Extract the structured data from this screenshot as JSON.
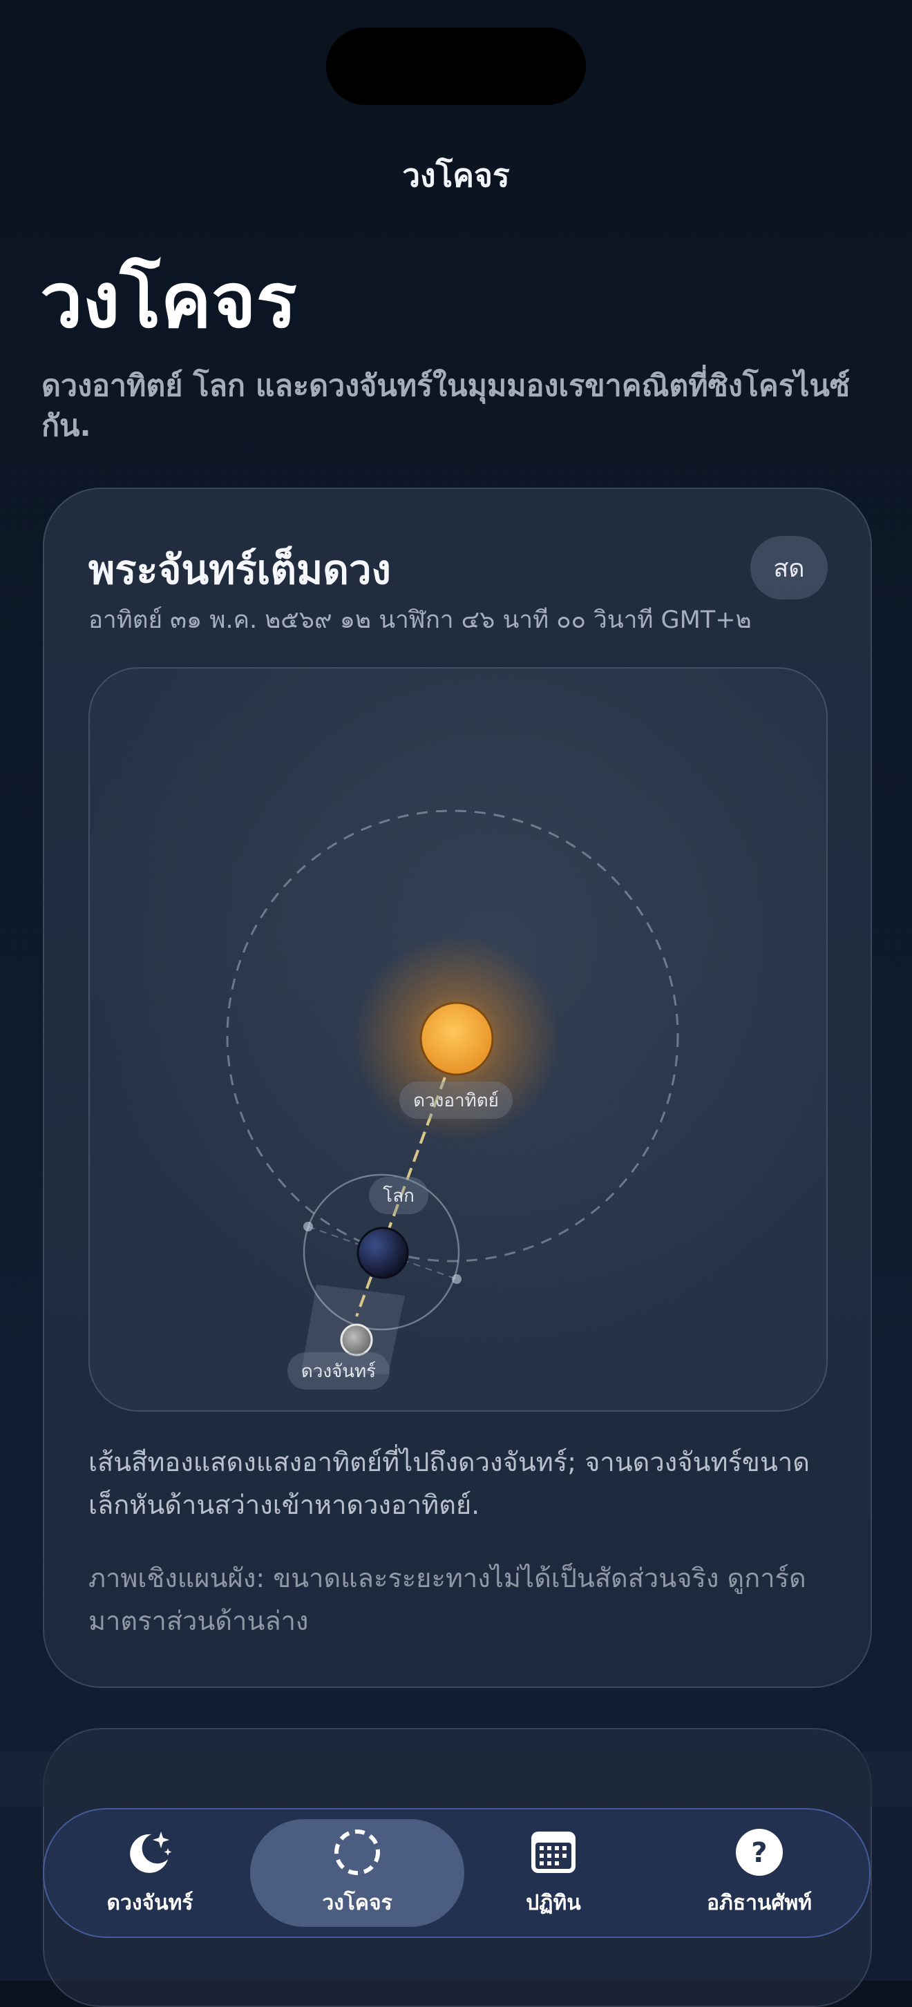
{
  "nav": {
    "title": "วงโคจร"
  },
  "header": {
    "title": "วงโคจร",
    "subtitle": "ดวงอาทิตย์ โลก และดวงจันทร์ในมุมมองเรขาคณิตที่ซิงโครไนซ์กัน."
  },
  "card": {
    "title": "พระจันทร์เต็มดวง",
    "badge": "สด",
    "date": "อาทิตย์ ๓๑ พ.ค. ๒๕๖๙ ๑๒ นาฬิกา ๔๖ นาที ๐๐ วินาที GMT+๒",
    "labels": {
      "sun": "ดวงอาทิตย์",
      "earth": "โลก",
      "moon": "ดวงจันทร์"
    },
    "note1": "เส้นสีทองแสดงแสงอาทิตย์ที่ไปถึงดวงจันทร์; จานดวงจันทร์ขนาดเล็กหันด้านสว่างเข้าหาดวงอาทิตย์.",
    "note2": "ภาพเชิงแผนผัง: ขนาดและระยะทางไม่ได้เป็นสัดส่วนจริง ดูการ์ดมาตราส่วนด้านล่าง"
  },
  "tabs": [
    {
      "label": "ดวงจันทร์",
      "icon": "moon-stars-icon",
      "active": false
    },
    {
      "label": "วงโคจร",
      "icon": "orbit-circle-icon",
      "active": true
    },
    {
      "label": "ปฏิทิน",
      "icon": "calendar-icon",
      "active": false
    },
    {
      "label": "อภิธานศัพท์",
      "icon": "question-icon",
      "active": false
    }
  ],
  "colors": {
    "sun": "#f5a83a",
    "sunlight_line": "#d8c98a",
    "tab_border": "#5a78c8",
    "active_tab": "#5a6c92"
  }
}
